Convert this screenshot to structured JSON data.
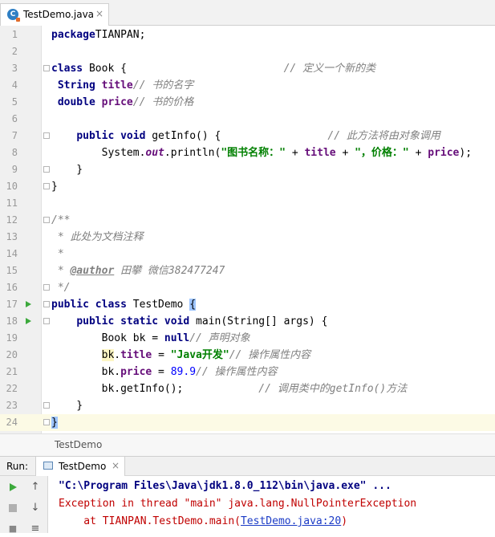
{
  "tab": {
    "file_name": "TestDemo.java",
    "icon": "C",
    "close": "×"
  },
  "editor": {
    "lines": [
      {
        "n": "1",
        "parts": [
          [
            "kw",
            "package"
          ],
          [
            "",
            "TIANPAN;"
          ]
        ]
      },
      {
        "n": "2",
        "parts": []
      },
      {
        "n": "3",
        "parts": [
          [
            "kw",
            "class"
          ],
          [
            "",
            " Book {                         "
          ],
          [
            "cm",
            "// 定义一个新的类"
          ]
        ]
      },
      {
        "n": "4",
        "parts": [
          [
            "",
            " "
          ],
          [
            "kw",
            "String"
          ],
          [
            "",
            " "
          ],
          [
            "fld",
            "title"
          ],
          [
            ";                    "
          ],
          [
            "cm",
            "// 书的名字"
          ]
        ]
      },
      {
        "n": "5",
        "parts": [
          [
            "",
            " "
          ],
          [
            "kw",
            "double"
          ],
          [
            "",
            " "
          ],
          [
            "fld",
            "price"
          ],
          [
            ";                    "
          ],
          [
            "cm",
            "// 书的价格"
          ]
        ]
      },
      {
        "n": "6",
        "parts": []
      },
      {
        "n": "7",
        "parts": [
          [
            "",
            "    "
          ],
          [
            "kw",
            "public void"
          ],
          [
            "",
            " getInfo() {                 "
          ],
          [
            "cm",
            "// 此方法将由对象调用"
          ]
        ]
      },
      {
        "n": "8",
        "parts": [
          [
            "",
            "        System."
          ],
          [
            "stat",
            "out"
          ],
          [
            "",
            ".println("
          ],
          [
            "str",
            "\"图书名称：\""
          ],
          [
            "",
            " + "
          ],
          [
            "fld",
            "title"
          ],
          [
            "",
            " + "
          ],
          [
            "str",
            "\"，价格：\""
          ],
          [
            "",
            " + "
          ],
          [
            "fld",
            "price"
          ],
          [
            "",
            ");"
          ]
        ]
      },
      {
        "n": "9",
        "parts": [
          [
            "",
            "    }"
          ]
        ]
      },
      {
        "n": "10",
        "parts": [
          [
            "",
            "}"
          ]
        ]
      },
      {
        "n": "11",
        "parts": []
      },
      {
        "n": "12",
        "parts": [
          [
            "cm",
            "/**"
          ]
        ]
      },
      {
        "n": "13",
        "parts": [
          [
            "cm",
            " * 此处为文档注释"
          ]
        ]
      },
      {
        "n": "14",
        "parts": [
          [
            "cm",
            " *"
          ]
        ]
      },
      {
        "n": "15",
        "parts": [
          [
            "cm",
            " * "
          ],
          [
            "tag",
            "@author"
          ],
          [
            "cm",
            " 田攀 微信382477247"
          ]
        ]
      },
      {
        "n": "16",
        "parts": [
          [
            "cm",
            " */"
          ]
        ]
      },
      {
        "n": "17",
        "parts": [
          [
            "kw",
            "public class"
          ],
          [
            "",
            " TestDemo "
          ],
          [
            "brace",
            "{"
          ]
        ]
      },
      {
        "n": "18",
        "parts": [
          [
            "",
            "    "
          ],
          [
            "kw",
            "public static void"
          ],
          [
            "",
            " main(String[] args) {"
          ]
        ]
      },
      {
        "n": "19",
        "parts": [
          [
            "",
            "        Book bk = "
          ],
          [
            "kw",
            "null"
          ],
          [
            ";            "
          ],
          [
            "cm",
            "// 声明对象"
          ]
        ]
      },
      {
        "n": "20",
        "parts": [
          [
            "",
            "        "
          ],
          [
            "hl",
            "bk"
          ],
          [
            "",
            "."
          ],
          [
            "fld",
            "title"
          ],
          [
            "",
            " = "
          ],
          [
            "str",
            "\"Java开发\""
          ],
          [
            ";         "
          ],
          [
            "cm",
            "// 操作属性内容"
          ]
        ]
      },
      {
        "n": "21",
        "parts": [
          [
            "",
            "        bk."
          ],
          [
            "fld",
            "price"
          ],
          [
            "",
            " = "
          ],
          [
            "num",
            "89.9"
          ],
          [
            ";             "
          ],
          [
            "cm",
            "// 操作属性内容"
          ]
        ]
      },
      {
        "n": "22",
        "parts": [
          [
            "",
            "        bk.getInfo();            "
          ],
          [
            "cm",
            "// 调用类中的getInfo()方法"
          ]
        ]
      },
      {
        "n": "23",
        "parts": [
          [
            "",
            "    }"
          ]
        ]
      },
      {
        "n": "24",
        "parts": [
          [
            "brace",
            "}"
          ]
        ]
      }
    ]
  },
  "breadcrumb": {
    "text": "TestDemo"
  },
  "run_panel": {
    "label": "Run:",
    "tab_name": "TestDemo",
    "tab_close": "×",
    "console": {
      "line1": "\"C:\\Program Files\\Java\\jdk1.8.0_112\\bin\\java.exe\" ...",
      "line2": "Exception in thread \"main\" java.lang.NullPointerException",
      "line3_prefix": "    at TIANPAN.TestDemo.main(",
      "line3_link": "TestDemo.java:20",
      "line3_suffix": ")"
    }
  }
}
